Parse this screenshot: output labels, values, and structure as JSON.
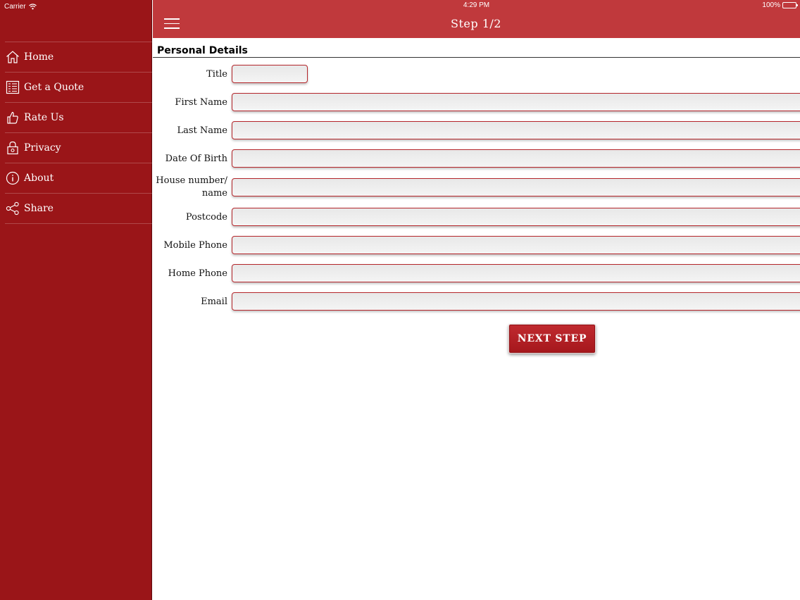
{
  "status_bar": {
    "carrier": "Carrier",
    "time": "4:29 PM",
    "battery": "100%"
  },
  "header": {
    "title": "Step 1/2"
  },
  "sidebar": {
    "items": [
      {
        "label": "Home",
        "icon": "home-icon"
      },
      {
        "label": "Get a Quote",
        "icon": "quote-list-icon"
      },
      {
        "label": "Rate Us",
        "icon": "thumbs-up-icon"
      },
      {
        "label": "Privacy",
        "icon": "lock-icon"
      },
      {
        "label": "About",
        "icon": "info-icon"
      },
      {
        "label": "Share",
        "icon": "share-icon"
      }
    ]
  },
  "form": {
    "section_title": "Personal Details",
    "fields": [
      {
        "label": "Title",
        "value": ""
      },
      {
        "label": "First Name",
        "value": ""
      },
      {
        "label": "Last Name",
        "value": ""
      },
      {
        "label": "Date Of Birth",
        "value": ""
      },
      {
        "label": "House number/ name",
        "value": ""
      },
      {
        "label": "Postcode",
        "value": ""
      },
      {
        "label": "Mobile Phone",
        "value": ""
      },
      {
        "label": "Home Phone",
        "value": ""
      },
      {
        "label": "Email",
        "value": ""
      }
    ],
    "next_label": "NEXT STEP"
  },
  "colors": {
    "sidebar": "#9a1518",
    "header": "#c0393c",
    "accent": "#b5262b"
  }
}
